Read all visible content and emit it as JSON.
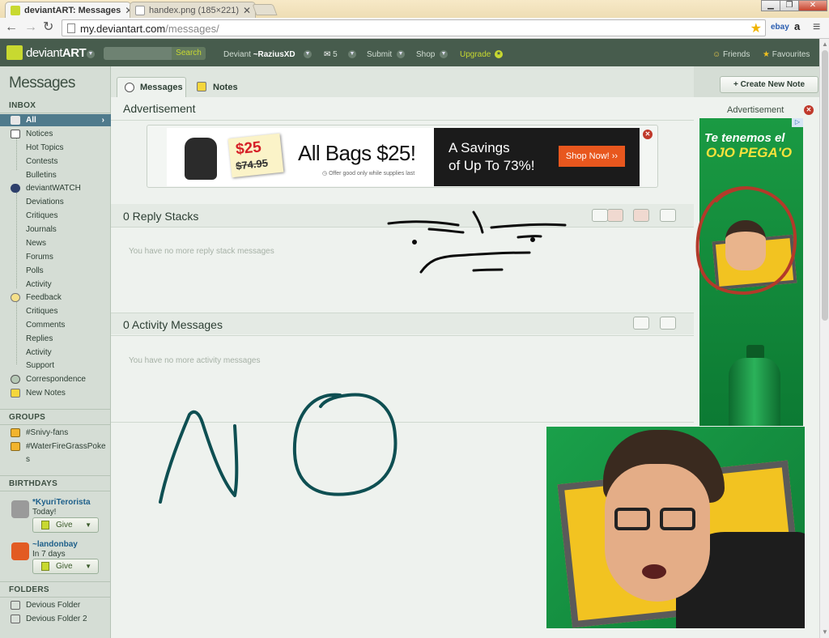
{
  "browser": {
    "tabs": [
      {
        "title": "deviantART: Messages",
        "active": true
      },
      {
        "title": "handex.png (185×221)",
        "active": false
      }
    ],
    "url_host": "my.deviantart.com",
    "url_path": "/messages/",
    "extensions": [
      "ebay",
      "a"
    ]
  },
  "da_bar": {
    "logo_text_light": "deviant",
    "logo_text_bold": "ART",
    "search_label": "Search",
    "user_prefix": "Deviant",
    "username": "~RaziusXD",
    "message_count": "5",
    "submit_label": "Submit",
    "shop_label": "Shop",
    "upgrade_label": "Upgrade",
    "friends_label": "Friends",
    "favourites_label": "Favourites"
  },
  "sidebar": {
    "title": "Messages",
    "inbox_heading": "INBOX",
    "inbox": [
      {
        "label": "All"
      },
      {
        "label": "Notices"
      },
      {
        "label": "Hot Topics"
      },
      {
        "label": "Contests"
      },
      {
        "label": "Bulletins"
      },
      {
        "label": "deviantWATCH"
      },
      {
        "label": "Deviations"
      },
      {
        "label": "Critiques"
      },
      {
        "label": "Journals"
      },
      {
        "label": "News"
      },
      {
        "label": "Forums"
      },
      {
        "label": "Polls"
      },
      {
        "label": "Activity"
      },
      {
        "label": "Feedback"
      },
      {
        "label": "Critiques"
      },
      {
        "label": "Comments"
      },
      {
        "label": "Replies"
      },
      {
        "label": "Activity"
      },
      {
        "label": "Support"
      },
      {
        "label": "Correspondence"
      },
      {
        "label": "New Notes"
      }
    ],
    "groups_heading": "GROUPS",
    "groups": [
      {
        "label": "#Snivy-fans"
      },
      {
        "label": "#WaterFireGrassPoke"
      },
      {
        "label": "s"
      }
    ],
    "birthdays_heading": "BIRTHDAYS",
    "birthdays": [
      {
        "name": "*KyuriTerorista",
        "when": "Today!",
        "give": "Give"
      },
      {
        "name": "~landonbay",
        "when": "In 7 days",
        "give": "Give"
      }
    ],
    "folders_heading": "FOLDERS",
    "folders": [
      {
        "label": "Devious Folder"
      },
      {
        "label": "Devious Folder 2"
      }
    ]
  },
  "main": {
    "tab_messages": "Messages",
    "tab_notes": "Notes",
    "create_note": "Create New Note",
    "advert_heading": "Advertisement",
    "reply_heading": "0 Reply Stacks",
    "reply_empty": "You have no more reply stack messages",
    "activity_heading": "0 Activity Messages",
    "activity_empty": "You have no more activity messages"
  },
  "banner_ad": {
    "price_new": "$25",
    "price_old": "$74.95",
    "headline": "All Bags $25!",
    "offer": "Offer good only while supplies last",
    "savings_line1": "A Savings",
    "savings_line2": "of Up To 73%!",
    "cta": "Shop Now! ››"
  },
  "side_ad": {
    "label": "Advertisement",
    "line1": "Te tenemos el",
    "line2": "OJO PEGA'O"
  },
  "colors": {
    "da_bar": "#475c4d",
    "selected_item": "#4f7a8c",
    "accent_green": "#c8d930",
    "ad_orange": "#e8571e",
    "doodle": "#0e4f52"
  }
}
